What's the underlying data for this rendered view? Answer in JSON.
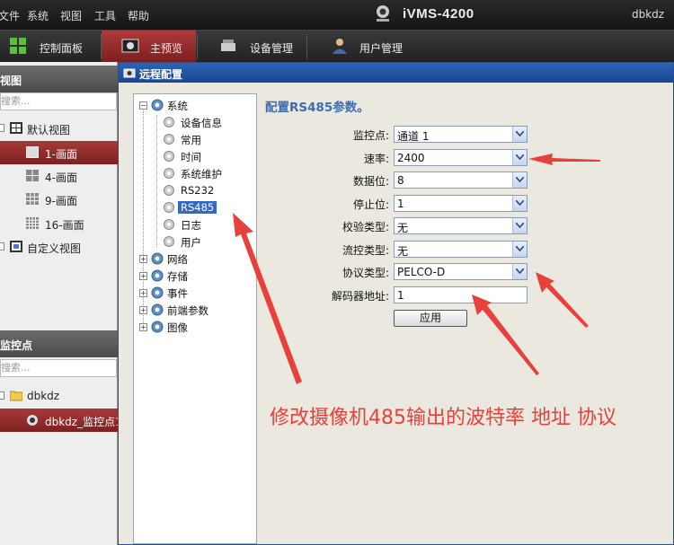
{
  "menubar": {
    "items": [
      "文件",
      "系统",
      "视图",
      "工具",
      "帮助"
    ],
    "app_title": "iVMS-4200",
    "user": "dbkdz"
  },
  "tabs": [
    {
      "label": "控制面板",
      "icon": "grid-icon"
    },
    {
      "label": "主预览",
      "icon": "camera-icon",
      "active": true
    },
    {
      "label": "设备管理",
      "icon": "device-icon"
    },
    {
      "label": "用户管理",
      "icon": "user-icon"
    }
  ],
  "left_panel": {
    "view_header": "视图",
    "view_search_placeholder": "搜索...",
    "default_view": "默认视图",
    "views": [
      "1-画面",
      "4-画面",
      "9-画面",
      "16-画面"
    ],
    "custom_view": "自定义视图",
    "monitor_header": "监控点",
    "monitor_search_placeholder": "搜索...",
    "group": "dbkdz",
    "camera": "dbkdz_监控点1"
  },
  "dialog": {
    "title": "远程配置",
    "tree": {
      "root": "系统",
      "children": [
        "设备信息",
        "常用",
        "时间",
        "系统维护",
        "RS232",
        "RS485",
        "日志",
        "用户"
      ],
      "others": [
        "网络",
        "存储",
        "事件",
        "前端参数",
        "图像"
      ]
    },
    "config_title": "配置RS485参数。",
    "fields": [
      {
        "label": "监控点:",
        "value": "通道 1"
      },
      {
        "label": "速率:",
        "value": "2400"
      },
      {
        "label": "数据位:",
        "value": "8"
      },
      {
        "label": "停止位:",
        "value": "1"
      },
      {
        "label": "校验类型:",
        "value": "无"
      },
      {
        "label": "流控类型:",
        "value": "无"
      },
      {
        "label": "协议类型:",
        "value": "PELCO-D"
      }
    ],
    "decoder_label": "解码器地址:",
    "decoder_value": "1",
    "apply_label": "应用"
  },
  "annotation": {
    "text": "修改摄像机485输出的波特率 地址 协议",
    "color": "#e8403a"
  }
}
